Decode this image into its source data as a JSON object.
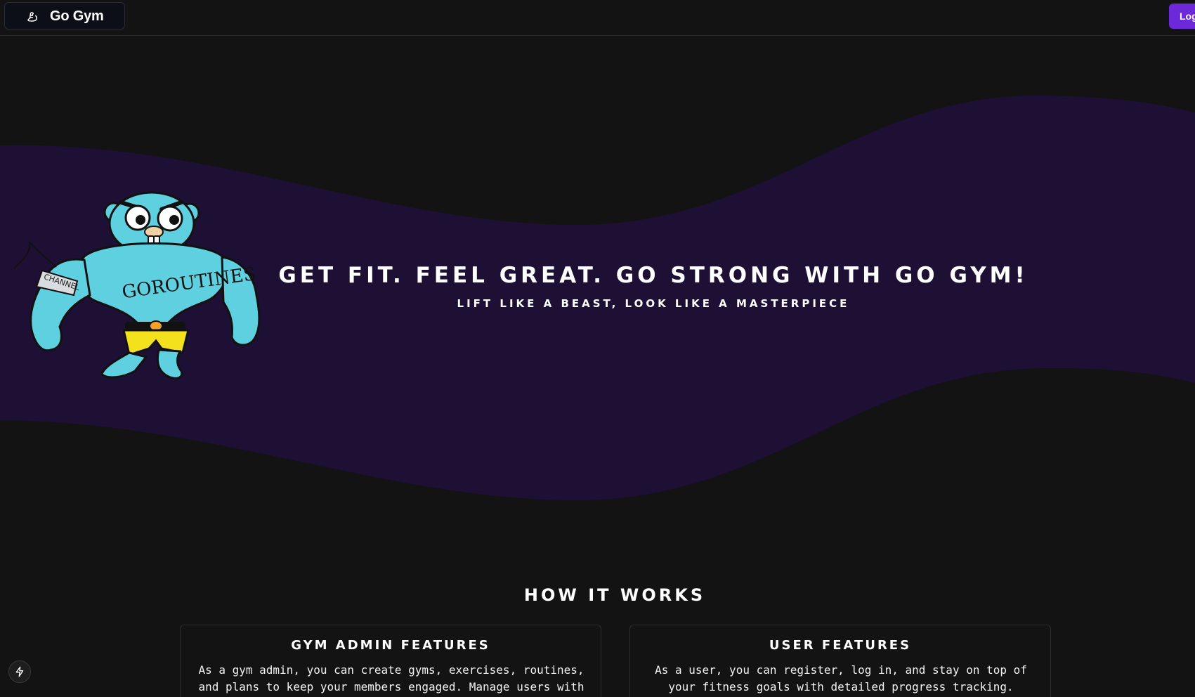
{
  "header": {
    "brand_name": "Go Gym",
    "brand_icon": "flexed-biceps-icon",
    "login_label": "Log"
  },
  "hero": {
    "title": "Get fit. Feel great. Go strong with Go Gym!",
    "subtitle": "Lift like a beast, look like a masterpiece",
    "mascot": {
      "description_icon": "muscular-gopher-mascot",
      "arm_band_text": "CHANNEL",
      "chest_text": "GOROUTINES"
    }
  },
  "how_it_works": {
    "title": "How it works",
    "cards": [
      {
        "title": "Gym admin features",
        "text": "As a gym admin, you can create gyms, exercises, routines, and plans to keep your members engaged. Manage users with"
      },
      {
        "title": "User features",
        "text": "As a user, you can register, log in, and stay on top of your fitness goals with detailed progress tracking."
      }
    ]
  },
  "floating": {
    "icon": "lightning-icon"
  },
  "colors": {
    "background": "#131313",
    "wave": "#1e0f35",
    "accent": "#6d28d9",
    "mascot_body": "#5ed0e0",
    "mascot_shorts": "#f2e11c"
  }
}
